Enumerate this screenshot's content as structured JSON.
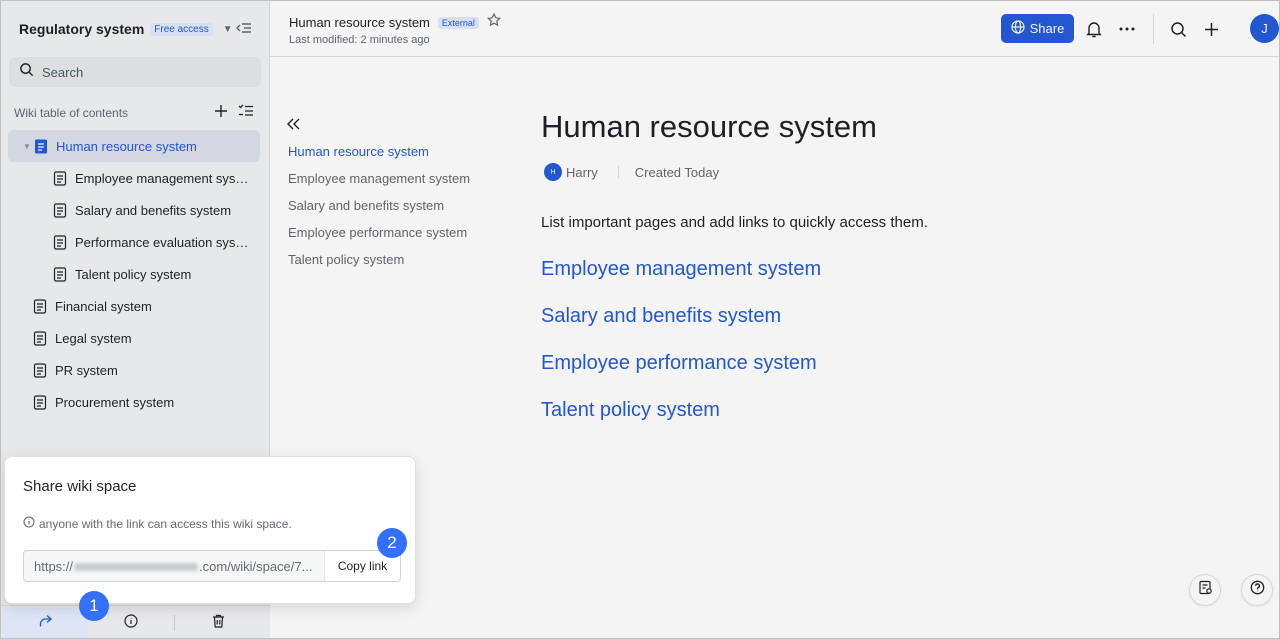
{
  "sidebar": {
    "space_title": "Regulatory system",
    "access_badge": "Free access",
    "search_placeholder": "Search",
    "toc_title": "Wiki table of contents",
    "items": [
      {
        "label": "Human resource system",
        "active": true
      },
      {
        "label": "Employee management system"
      },
      {
        "label": "Salary and benefits system"
      },
      {
        "label": "Performance evaluation system"
      },
      {
        "label": "Talent policy system"
      },
      {
        "label": "Financial system"
      },
      {
        "label": "Legal system"
      },
      {
        "label": "PR system"
      },
      {
        "label": "Procurement system"
      }
    ]
  },
  "share_popup": {
    "title": "Share wiki space",
    "note": "anyone with the link can access this wiki space.",
    "link_prefix": "https://",
    "link_suffix": ".com/wiki/space/7...",
    "copy_label": "Copy link"
  },
  "steps": [
    "1",
    "2"
  ],
  "topbar": {
    "doc_title": "Human resource system",
    "external_badge": "External",
    "last_modified": "Last modified: 2 minutes ago",
    "share_label": "Share",
    "avatar_initial": "J"
  },
  "outline": [
    "Human resource system",
    "Employee management system",
    "Salary and benefits system",
    "Employee performance system",
    "Talent policy system"
  ],
  "document": {
    "title": "Human resource system",
    "author_initial": "H",
    "author": "Harry",
    "created": "Created Today",
    "intro": "List important pages and add links to quickly access them.",
    "links": [
      "Employee management system",
      "Salary and benefits system",
      "Employee performance system",
      "Talent policy system"
    ]
  },
  "colors": {
    "accent": "#245bdb",
    "step_badge": "#3370ff",
    "sidebar_bg": "#f2f3f5"
  }
}
